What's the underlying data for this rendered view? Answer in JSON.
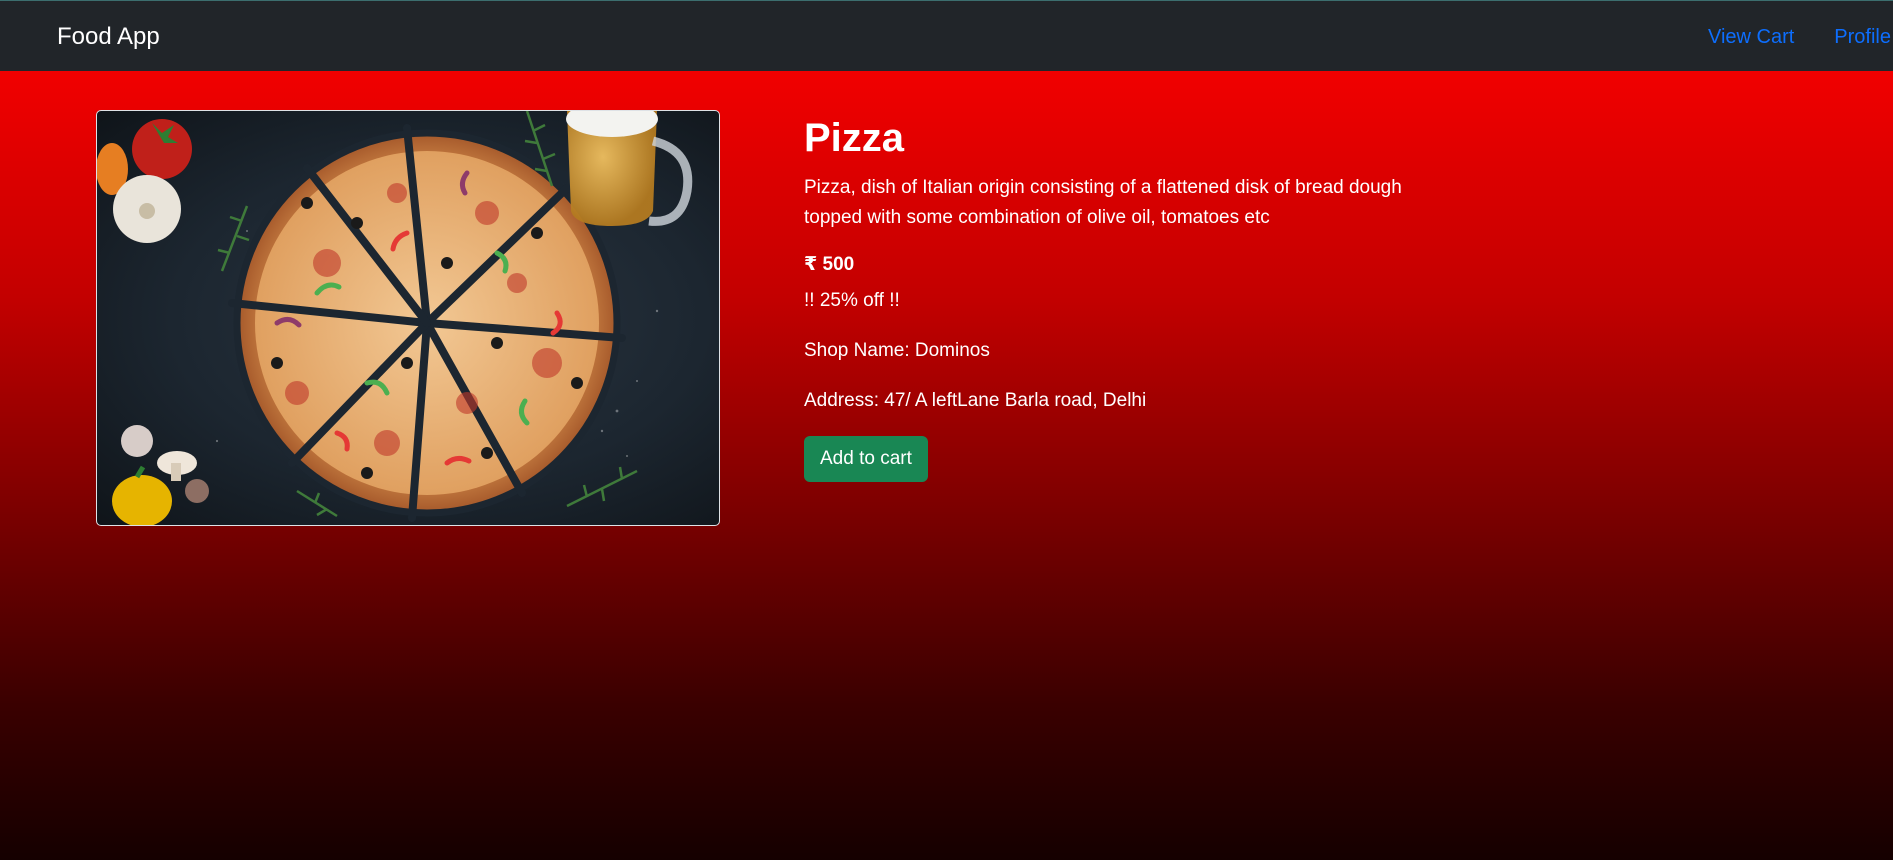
{
  "navbar": {
    "brand": "Food App",
    "links": [
      "View Cart",
      "Profile"
    ]
  },
  "product": {
    "image_alt": "pizza-photo",
    "name": "Pizza",
    "description": "Pizza, dish of Italian origin consisting of a flattened disk of bread dough topped with some combination of olive oil, tomatoes etc",
    "price": "₹ 500",
    "discount": "!! 25% off !!",
    "shop": "Shop Name: Dominos",
    "address": "Address: 47/ A leftLane Barla road, Delhi",
    "add_to_cart": "Add to cart"
  },
  "colors": {
    "navbar_bg": "#212529",
    "link": "#0d6efd",
    "button": "#198754",
    "gradient_top": "#ff0000",
    "gradient_bottom": "#150000"
  }
}
